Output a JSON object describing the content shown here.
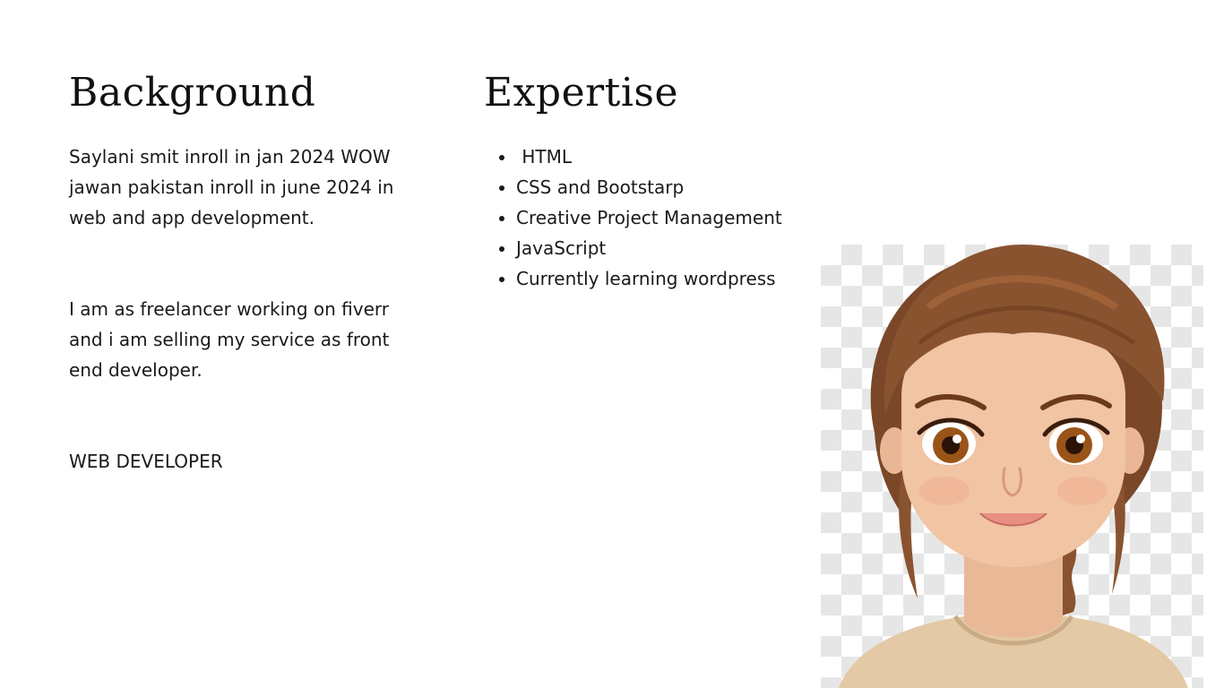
{
  "background": {
    "title": "Background",
    "paragraph_1": "Saylani smit inroll in jan 2024 WOW jawan pakistan inroll in june 2024 in web and app development.",
    "paragraph_2": "I am as freelancer working on fiverr and i am selling my service as front end developer.",
    "role": "WEB DEVELOPER"
  },
  "expertise": {
    "title": "Expertise",
    "items": [
      " HTML",
      "CSS and Bootstarp",
      "Creative Project Management",
      "JavaScript",
      "Currently learning wordpress"
    ]
  },
  "avatar": {
    "icon": "cartoon-girl-portrait",
    "colors": {
      "hair": "#8a5330",
      "skin": "#f1c4a3",
      "shirt": "#e3c9a5",
      "eyes": "#7a3f12",
      "checker": "#e6e6e6"
    }
  }
}
